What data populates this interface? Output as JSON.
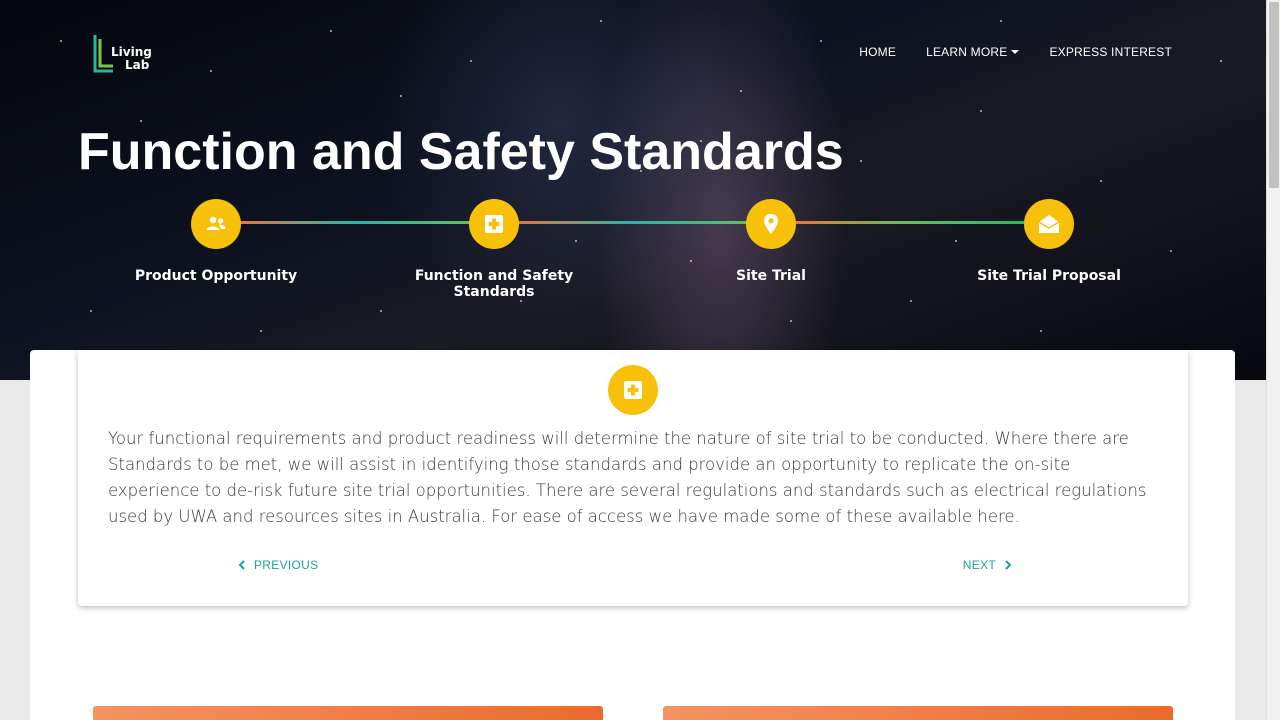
{
  "brand": {
    "logo_line1": "Living",
    "logo_line2": "Lab",
    "accent": "#f7c10b",
    "link": "#1aa39a"
  },
  "nav": {
    "home": "HOME",
    "learn_more": "LEARN MORE",
    "express_interest": "EXPRESS INTEREST"
  },
  "hero": {
    "title": "Function and Safety Standards"
  },
  "steps": [
    {
      "label": "Product Opportunity",
      "icon": "users-icon"
    },
    {
      "label": "Function and Safety Standards",
      "icon": "medical-plus-icon"
    },
    {
      "label": "Site Trial",
      "icon": "map-pin-icon"
    },
    {
      "label": "Site Trial Proposal",
      "icon": "envelope-open-icon"
    }
  ],
  "content": {
    "icon": "medical-plus-icon",
    "body": "Your functional requirements and product readiness will determine the nature of site trial to be conducted. Where there are Standards to be met, we will assist in identifying those standards and provide an opportunity to replicate the on-site experience to de-risk future site trial opportunities. There are several regulations and standards such as electrical regulations used by UWA and resources sites in Australia. For ease of access we have made some of these available here.",
    "previous": "PREVIOUS",
    "next": "NEXT"
  }
}
